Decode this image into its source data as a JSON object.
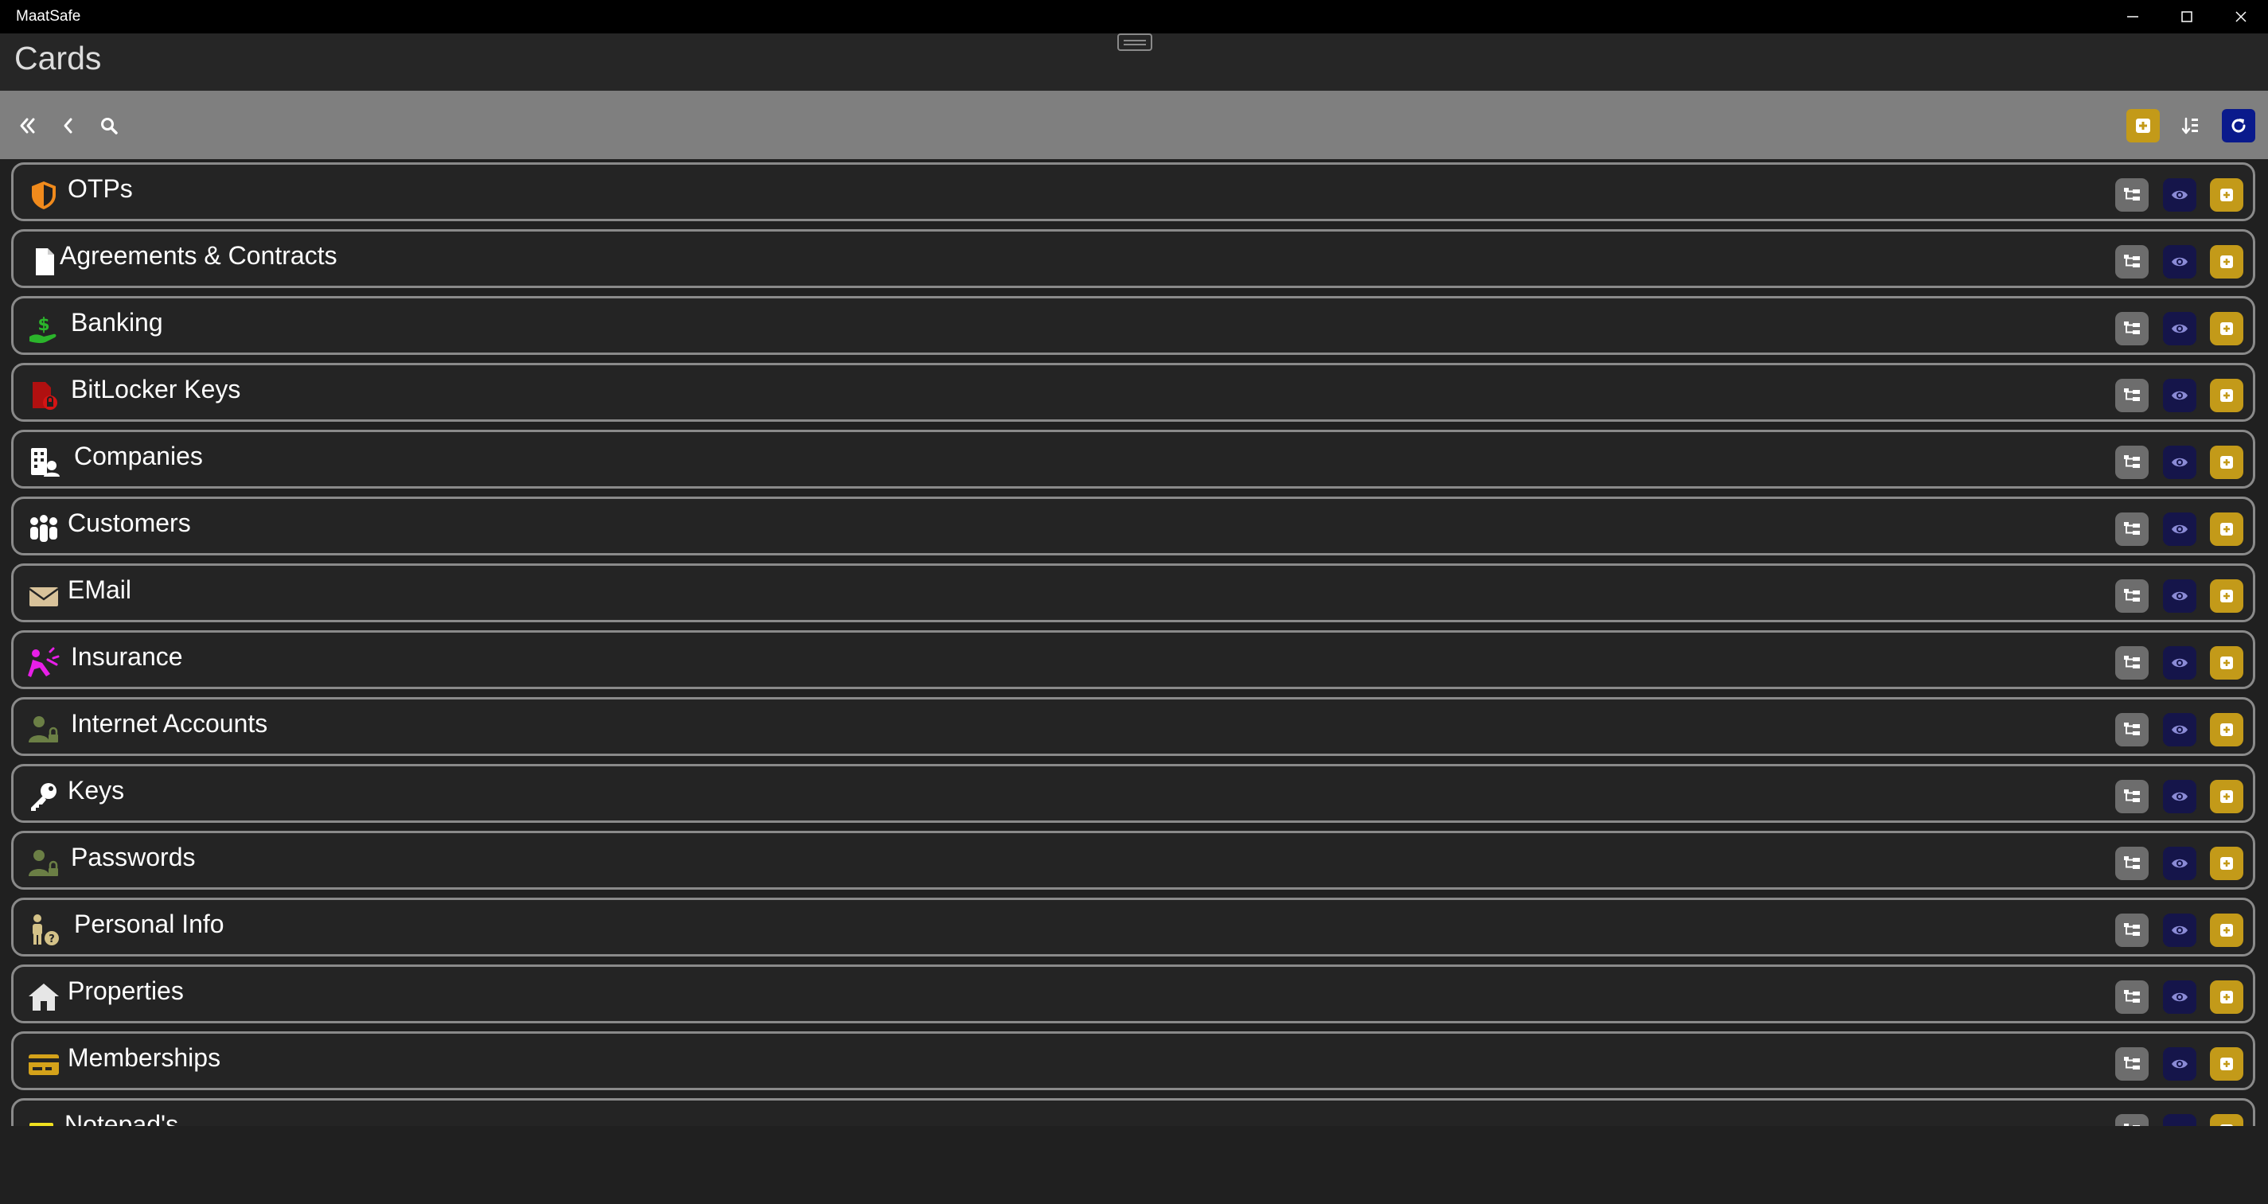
{
  "window": {
    "app_name": "MaatSafe"
  },
  "header": {
    "title": "Cards"
  },
  "colors": {
    "add_gold": "#c39a19",
    "view_navy": "#15154a",
    "tree_gray": "#6d6d6d",
    "refresh_blue": "#0a1a8c"
  },
  "categories": [
    {
      "label": "OTPs",
      "icon": "shield-icon"
    },
    {
      "label": "Agreements & Contracts",
      "icon": "document-icon"
    },
    {
      "label": "Banking",
      "icon": "money-hand-icon"
    },
    {
      "label": "BitLocker Keys",
      "icon": "locked-file-icon"
    },
    {
      "label": "Companies",
      "icon": "building-person-icon"
    },
    {
      "label": "Customers",
      "icon": "people-group-icon"
    },
    {
      "label": "EMail",
      "icon": "envelope-icon"
    },
    {
      "label": "Insurance",
      "icon": "accident-icon"
    },
    {
      "label": "Internet Accounts",
      "icon": "user-lock-icon"
    },
    {
      "label": "Keys",
      "icon": "key-icon"
    },
    {
      "label": "Passwords",
      "icon": "user-lock-icon"
    },
    {
      "label": "Personal Info",
      "icon": "person-question-icon"
    },
    {
      "label": "Properties",
      "icon": "house-icon"
    },
    {
      "label": "Memberships",
      "icon": "card-icon"
    },
    {
      "label": "Notepad's",
      "icon": "note-icon"
    }
  ]
}
